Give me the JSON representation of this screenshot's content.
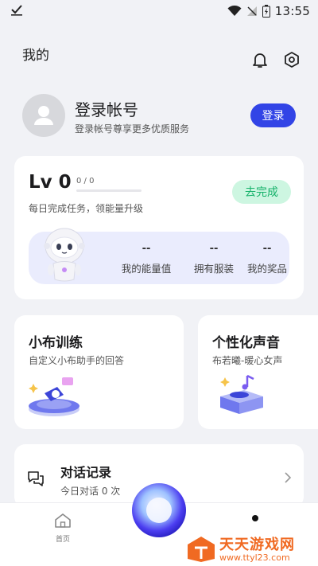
{
  "status_bar": {
    "time": "13:55",
    "icons": [
      "check-icon",
      "wifi-icon",
      "no-signal-icon",
      "battery-icon"
    ]
  },
  "header": {
    "title": "我的",
    "icons": [
      "bell-icon",
      "settings-icon"
    ]
  },
  "profile": {
    "title": "登录帐号",
    "subtitle": "登录帐号尊享更多优质服务",
    "login_label": "登录"
  },
  "level": {
    "title": "Lv 0",
    "progress_text": "0 / 0",
    "progress_fraction": 0,
    "subtitle": "每日完成任务，领能量升级",
    "action_label": "去完成",
    "stats": [
      {
        "value": "--",
        "label": "我的能量值"
      },
      {
        "value": "--",
        "label": "拥有服装"
      },
      {
        "value": "--",
        "label": "我的奖品"
      }
    ]
  },
  "features": {
    "training": {
      "title": "小布训练",
      "subtitle": "自定义小布助手的回答"
    },
    "voice": {
      "title": "个性化声音",
      "subtitle": "布若曦-暖心女声"
    }
  },
  "chat_history": {
    "title": "对话记录",
    "subtitle": "今日对话 0 次"
  },
  "tabbar": {
    "home_label": "首页"
  },
  "watermark": {
    "title": "天天游戏网",
    "url": "www.ttyl23.com"
  },
  "colors": {
    "accent": "#3244e6",
    "success_bg": "#cdf6e1",
    "success_text": "#16b26a",
    "page_bg": "#f1f2f6"
  }
}
